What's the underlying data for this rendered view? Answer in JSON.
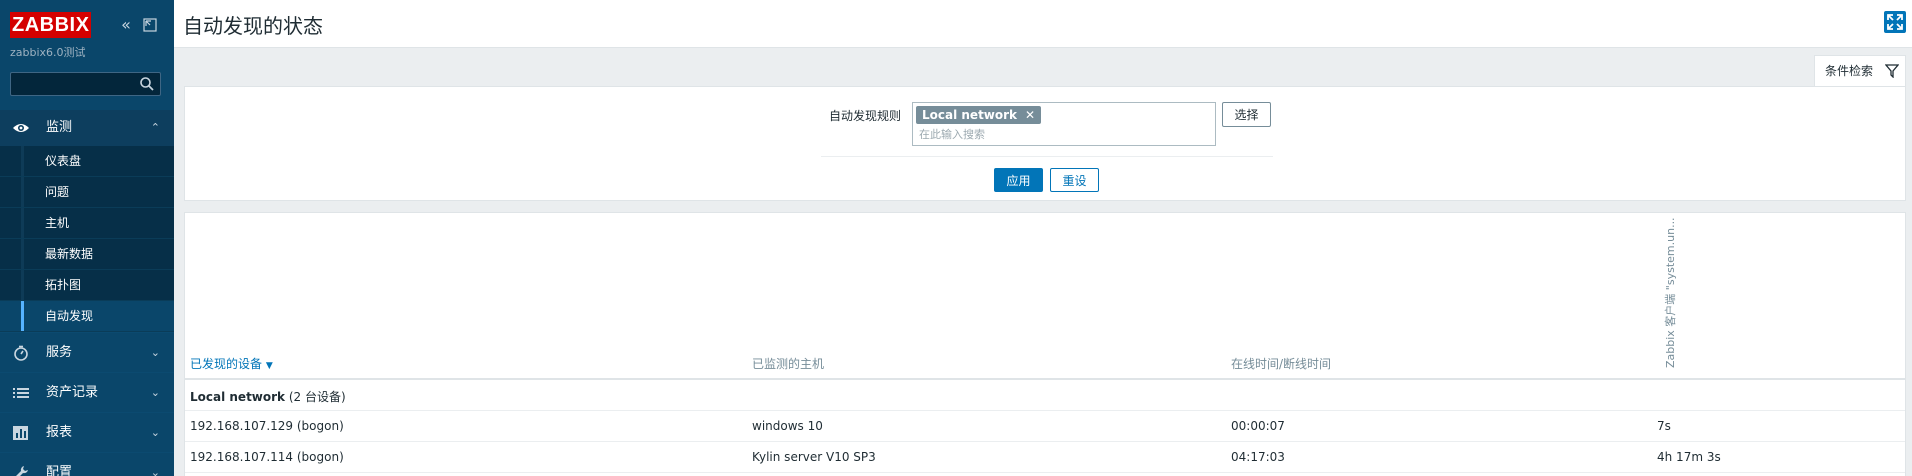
{
  "sidebar": {
    "logo": "ZABBIX",
    "server_name": "zabbix6.0测试",
    "search_value": "",
    "menu": {
      "monitoring": "监测",
      "services": "服务",
      "inventory": "资产记录",
      "reports": "报表",
      "configuration": "配置"
    },
    "submenu": {
      "dashboards": "仪表盘",
      "problems": "问题",
      "hosts": "主机",
      "latest_data": "最新数据",
      "maps": "拓扑图",
      "discovery": "自动发现"
    }
  },
  "header": {
    "title": "自动发现的状态"
  },
  "filter": {
    "tab_label": "条件检索",
    "rule_label": "自动发现规则",
    "tag": "Local network",
    "search_placeholder": "在此输入搜索",
    "select_label": "选择",
    "apply_label": "应用",
    "reset_label": "重设"
  },
  "table": {
    "columns": {
      "device": "已发现的设备",
      "host": "已监测的主机",
      "uptime": "在线时间/断线时间",
      "check": "Zabbix 客户端 \"system.un..."
    },
    "group": {
      "name": "Local network",
      "count": "(2 台设备)"
    },
    "rows": [
      {
        "device": "192.168.107.129 (bogon)",
        "host": "windows 10",
        "uptime": "00:00:07",
        "check": "7s"
      },
      {
        "device": "192.168.107.114 (bogon)",
        "host": "Kylin server V10 SP3",
        "uptime": "04:17:03",
        "check": "4h 17m 3s"
      }
    ]
  },
  "colors": {
    "sidebar_bg": "#0a466a",
    "accent": "#0275b8",
    "logo_red": "#d40000",
    "active_marker": "#56b3ff"
  }
}
